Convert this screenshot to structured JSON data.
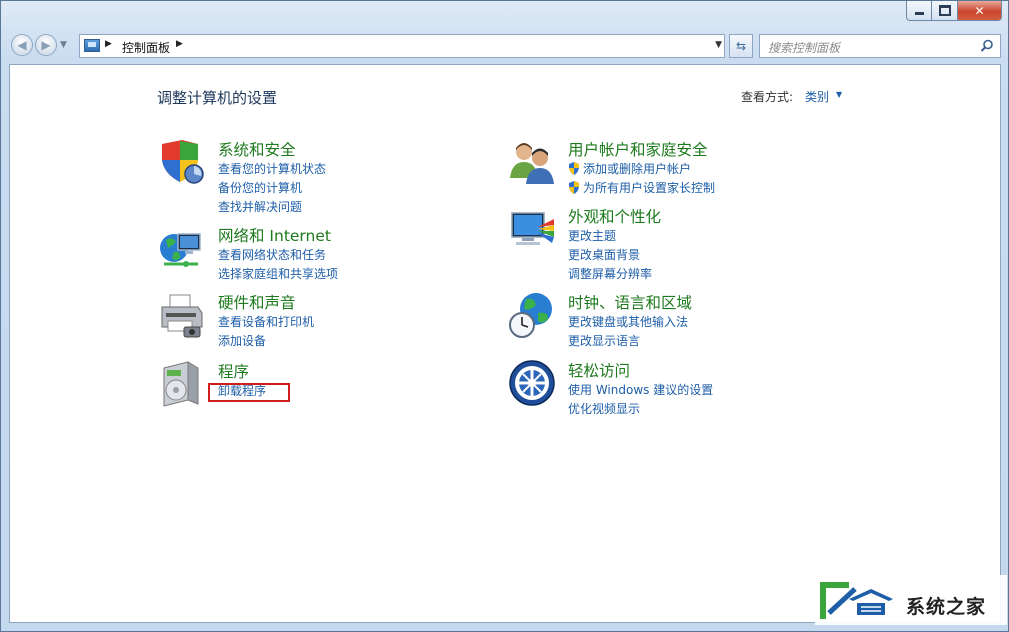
{
  "window": {
    "caption_buttons": {
      "minimize": "▭",
      "maximize": "□",
      "close": "✕"
    }
  },
  "navbar": {
    "breadcrumb": "控制面板",
    "search_placeholder": "搜索控制面板"
  },
  "content": {
    "title": "调整计算机的设置",
    "view_by_label": "查看方式:",
    "view_by_value": "类别"
  },
  "categories": [
    {
      "title": "系统和安全",
      "icon": "shield-icon",
      "links": [
        "查看您的计算机状态",
        "备份您的计算机",
        "查找并解决问题"
      ]
    },
    {
      "title": "网络和 Internet",
      "icon": "network-icon",
      "links": [
        "查看网络状态和任务",
        "选择家庭组和共享选项"
      ]
    },
    {
      "title": "硬件和声音",
      "icon": "printer-icon",
      "links": [
        "查看设备和打印机",
        "添加设备"
      ]
    },
    {
      "title": "程序",
      "icon": "programs-icon",
      "links": [
        "卸载程序"
      ]
    },
    {
      "title": "用户帐户和家庭安全",
      "icon": "users-icon",
      "links": [
        "添加或删除用户帐户",
        "为所有用户设置家长控制"
      ]
    },
    {
      "title": "外观和个性化",
      "icon": "display-icon",
      "links": [
        "更改主题",
        "更改桌面背景",
        "调整屏幕分辨率"
      ]
    },
    {
      "title": "时钟、语言和区域",
      "icon": "globe-clock-icon",
      "links": [
        "更改键盘或其他输入法",
        "更改显示语言"
      ]
    },
    {
      "title": "轻松访问",
      "icon": "ease-of-access-icon",
      "links": [
        "使用 Windows 建议的设置",
        "优化视频显示"
      ]
    }
  ],
  "watermark": {
    "text": "系统之家"
  },
  "colors": {
    "title_green": "#1e7a1e",
    "link_blue": "#1e5ea8",
    "highlight_red": "#d11c1c"
  }
}
